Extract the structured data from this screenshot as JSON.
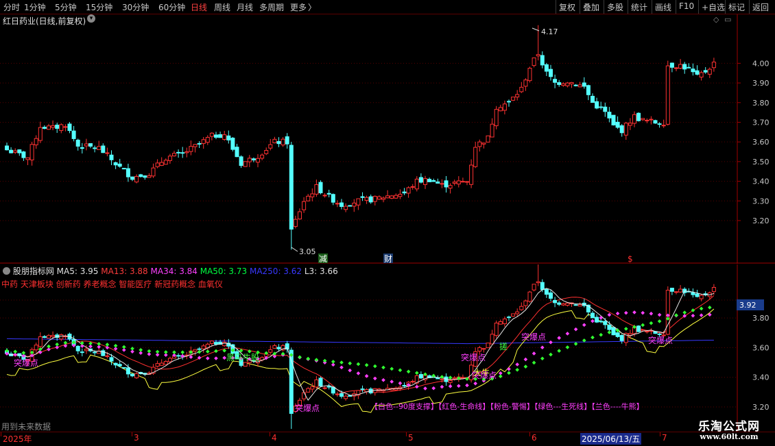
{
  "toolbar": {
    "periods": [
      "分时",
      "1分钟",
      "5分钟",
      "15分钟",
      "30分钟",
      "60分钟",
      "日线",
      "周线",
      "月线",
      "多周期",
      "更多"
    ],
    "active_period": "日线",
    "more_arrow": "〉",
    "right_buttons": [
      "复权",
      "叠加",
      "多股",
      "统计",
      "画线",
      "F10",
      "+自选",
      "标记",
      "返回"
    ]
  },
  "main": {
    "stock_title": "红日药业(日线,前复权)",
    "high_label": "4.17",
    "low_label": "3.05",
    "price_ticks": [
      "4.00",
      "3.90",
      "3.80",
      "3.70",
      "3.60",
      "3.50",
      "3.40",
      "3.30",
      "3.20"
    ],
    "event_markers": [
      {
        "text": "减",
        "color": "#ffffff",
        "bg": "#1a5e1a"
      },
      {
        "text": "财",
        "color": "#ffffff",
        "bg": "#1a3a6e"
      },
      {
        "text": "$",
        "color": "#ff3030",
        "bg": ""
      }
    ]
  },
  "indicator": {
    "name": "股朋指标网",
    "values": [
      {
        "label": "MA5: 3.95",
        "color": "#e0e0e0"
      },
      {
        "label": "MA13: 3.88",
        "color": "#ff3c3c"
      },
      {
        "label": "MA34: 3.84",
        "color": "#ff40ff"
      },
      {
        "label": "MA50: 3.73",
        "color": "#00ff40"
      },
      {
        "label": "MA250: 3.62",
        "color": "#3838ff"
      },
      {
        "label": "L3: 3.66",
        "color": "#e0e0e0"
      }
    ],
    "concepts": "中药 天津板块 创新药 养老概念 智能医疗 新冠药概念 血氧仪",
    "axis_ticks": [
      "3.80",
      "3.60",
      "3.40",
      "3.20"
    ],
    "current_price_tag": "3.92",
    "legend_text": "【白色--90度支撑】【红色-生命线】【粉色-警惕】【绿色---生死线】【兰色----牛熊】",
    "footer_note": "用到未来数据",
    "annotations": [
      {
        "text": "突爆点",
        "color": "#ff40ff"
      },
      {
        "text": "突爆点",
        "color": "#ff40ff"
      },
      {
        "text": "突爆点",
        "color": "#ff40ff"
      },
      {
        "text": "突爆点",
        "color": "#ff40ff"
      },
      {
        "text": "突爆点",
        "color": "#ff40ff"
      },
      {
        "text": "突爆点",
        "color": "#ff40ff"
      },
      {
        "text": "黑马牛股",
        "color": "#40ff40"
      },
      {
        "text": "搓",
        "color": "#40ff40"
      },
      {
        "text": "大牛",
        "color": "#ffff40"
      }
    ]
  },
  "datebar": {
    "labels": [
      "2025年",
      "3",
      "4",
      "5",
      "6",
      "7"
    ],
    "cursor_date": "2025/06/13/五"
  },
  "watermark": {
    "title": "乐淘公式网",
    "url": "www.60lt.com"
  },
  "colors": {
    "up": "#ff3232",
    "down": "#54ffff",
    "grid": "#5a0000",
    "axis": "#a00000"
  }
}
